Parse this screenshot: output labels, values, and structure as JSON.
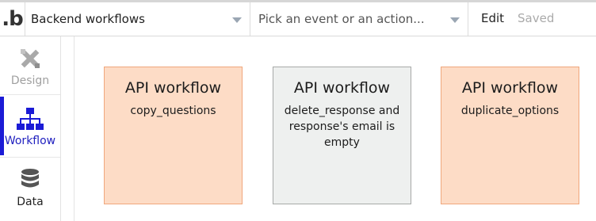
{
  "topbar": {
    "logo_text": ".b",
    "page_select": {
      "value": "Backend workflows"
    },
    "event_select": {
      "placeholder": "Pick an event or an action..."
    },
    "edit_label": "Edit",
    "status_label": "Saved"
  },
  "nav": {
    "items": [
      {
        "label": "Design",
        "icon": "design-icon",
        "active": false
      },
      {
        "label": "Workflow",
        "icon": "workflow-icon",
        "active": true
      },
      {
        "label": "Data",
        "icon": "database-icon",
        "active": false
      }
    ]
  },
  "workflows": [
    {
      "title": "API workflow",
      "name": "copy_questions",
      "color": "#fddcc6"
    },
    {
      "title": "API workflow",
      "name": "delete_response and response's email is empty",
      "color": "#eef0ef"
    },
    {
      "title": "API workflow",
      "name": "duplicate_options",
      "color": "#fddcc6"
    }
  ],
  "colors": {
    "accent": "#1b1bd6",
    "api_workflow_bg": "#fddcc6",
    "api_workflow_border": "#f0a77d",
    "inactive_workflow_bg": "#eef0ef"
  }
}
